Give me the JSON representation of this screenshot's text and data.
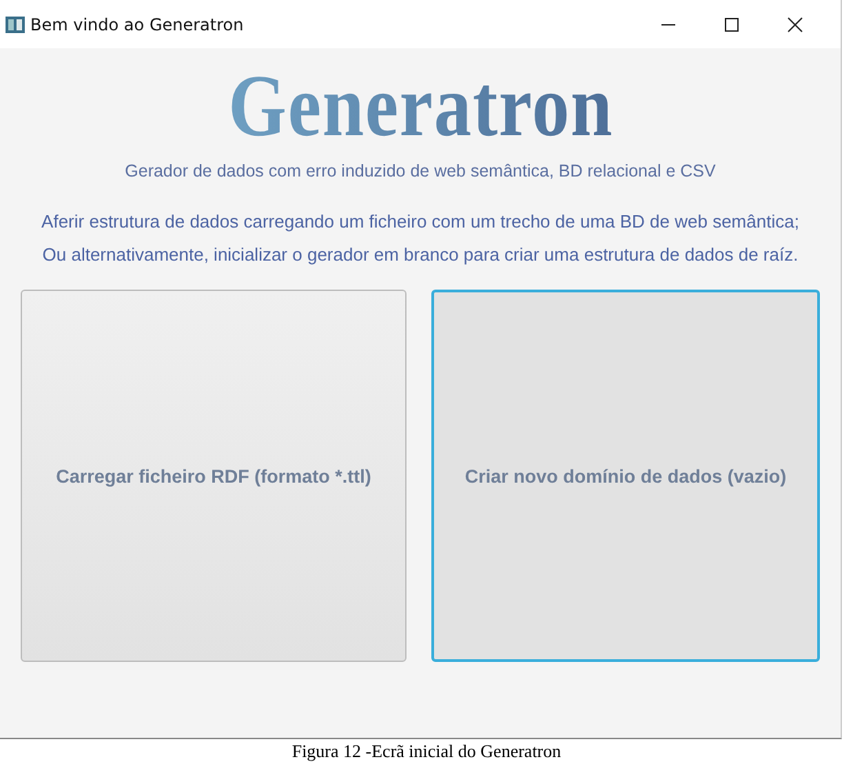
{
  "window": {
    "title": "Bem vindo ao Generatron"
  },
  "logo": "Generatron",
  "subtitle": "Gerador de dados com erro induzido de web semântica, BD relacional e CSV",
  "instructions": [
    "Aferir estrutura de dados carregando um ficheiro com um trecho de uma BD de web semântica;",
    "Ou alternativamente, inicializar o gerador em branco para criar uma estrutura de dados de raíz."
  ],
  "buttons": [
    {
      "label": "Carregar ficheiro RDF (formato *.ttl)",
      "focused": false
    },
    {
      "label": "Criar novo domínio de dados (vazio)",
      "focused": true
    }
  ],
  "caption": "Figura 12 -Ecrã inicial do Generatron"
}
